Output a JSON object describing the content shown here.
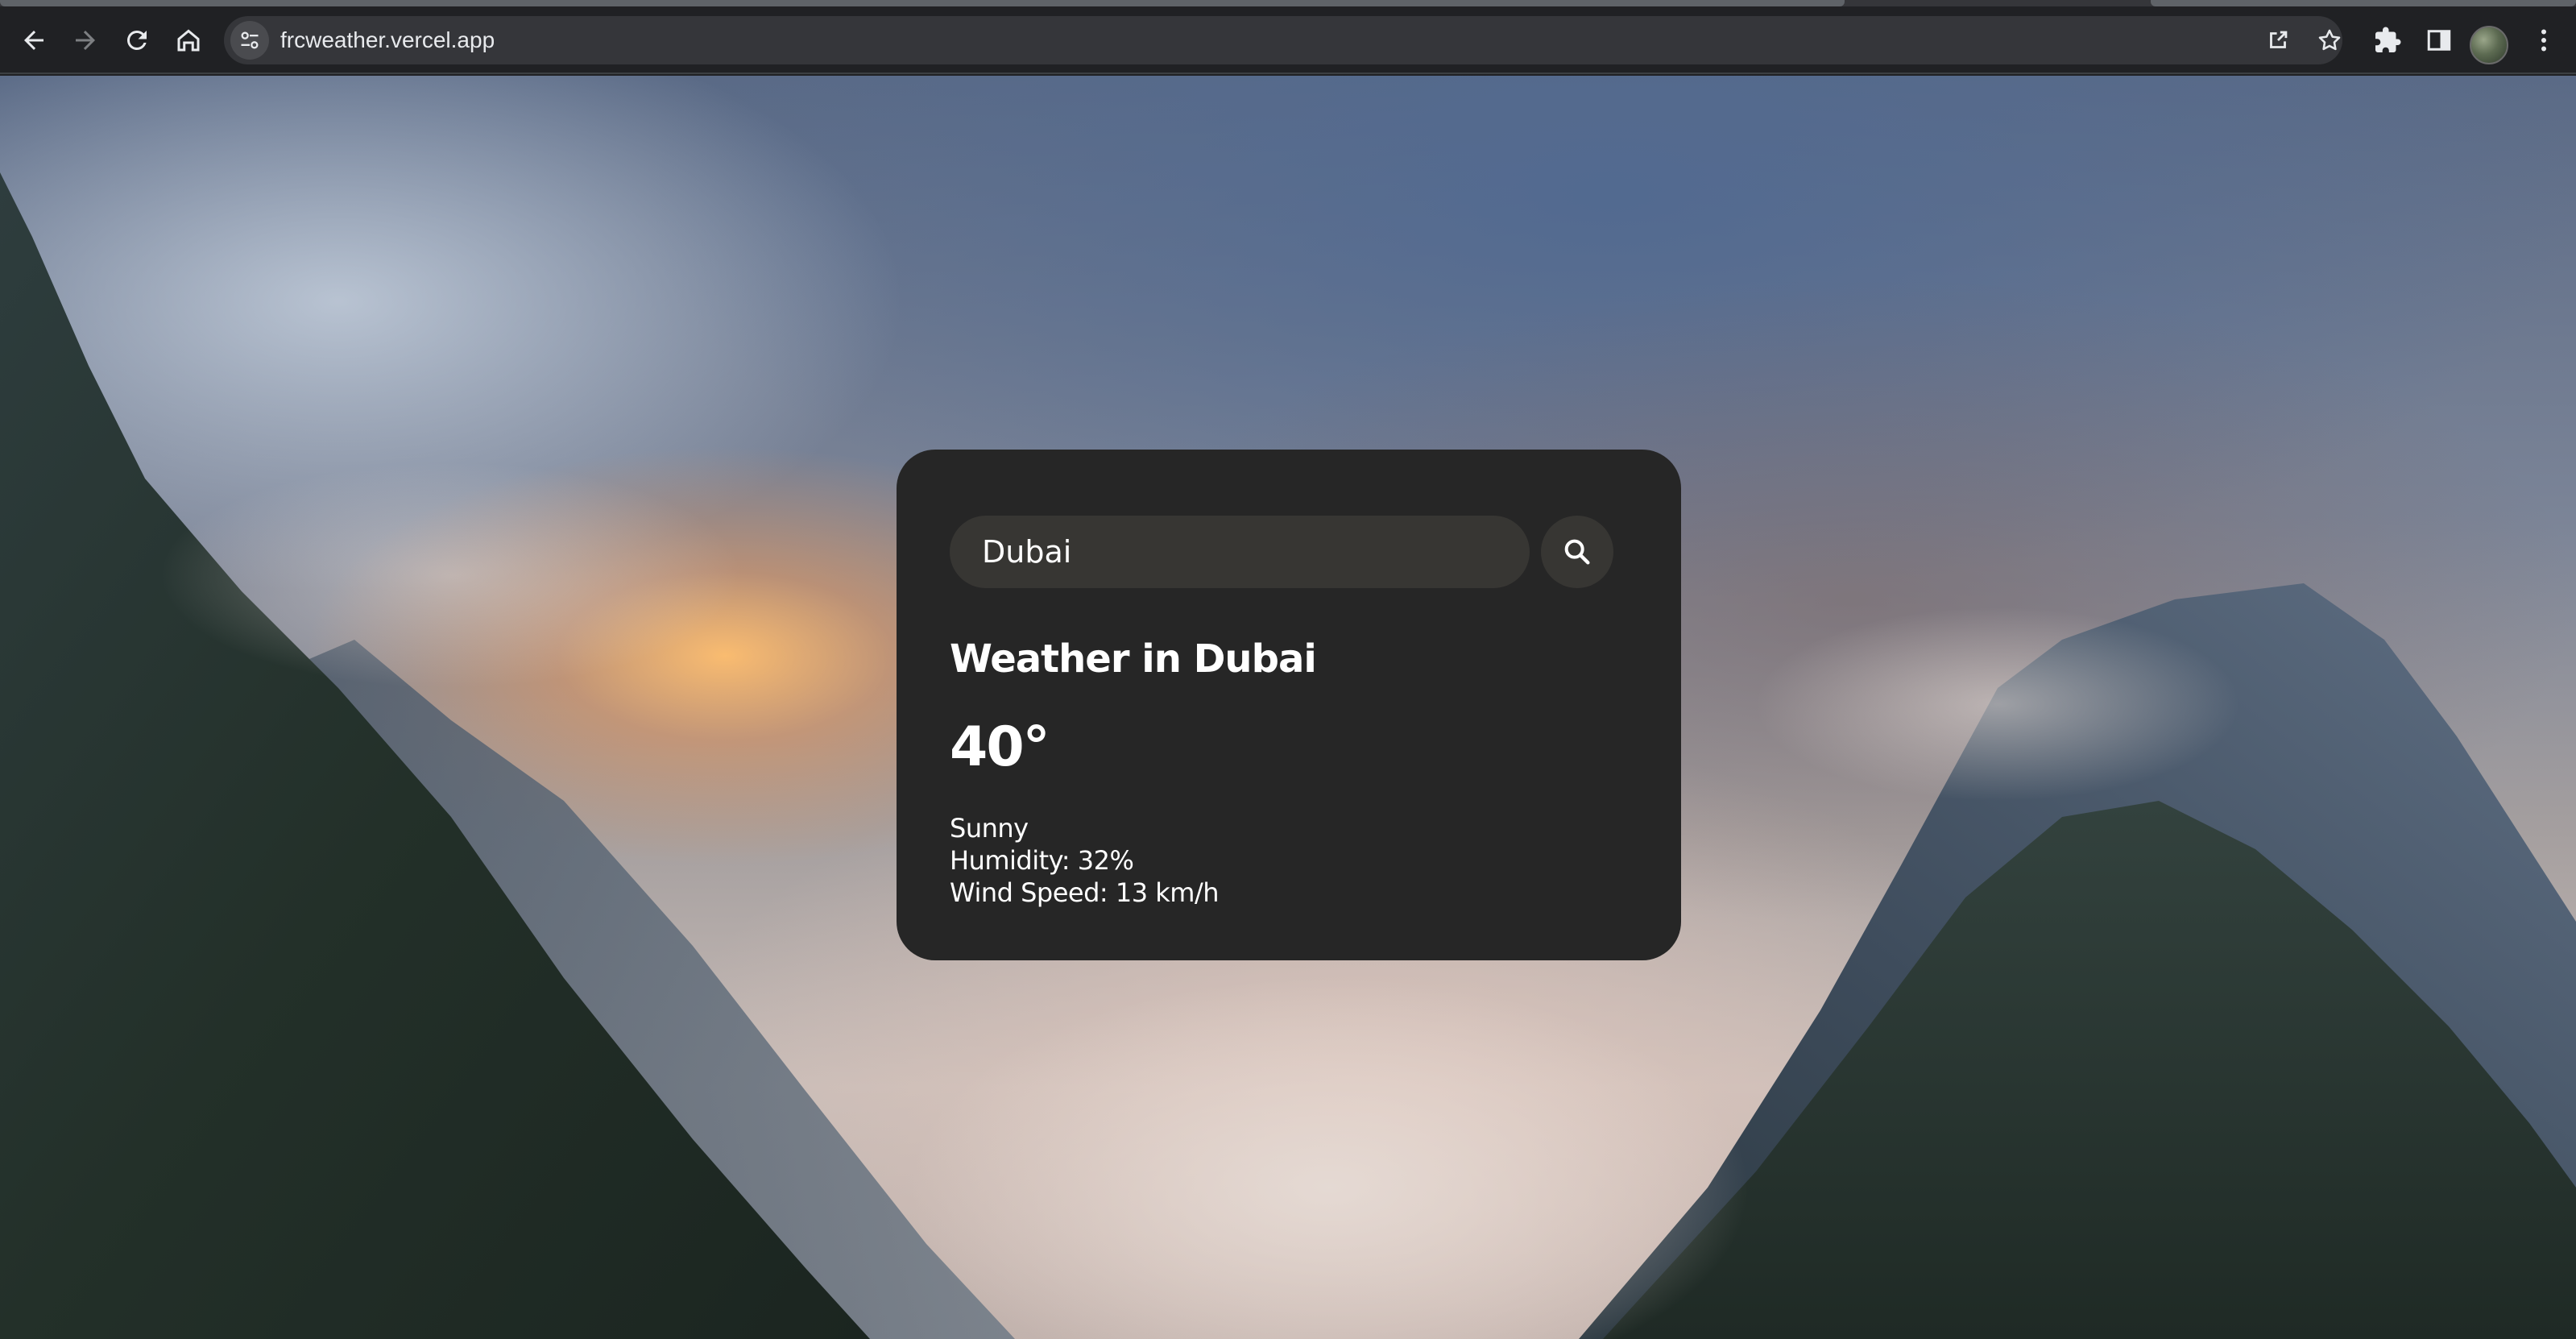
{
  "browser": {
    "url": "frcweather.vercel.app",
    "icons": {
      "back": "arrow-left-icon",
      "forward": "arrow-right-icon",
      "reload": "reload-icon",
      "home": "home-icon",
      "site_info": "tune-icon",
      "share": "share-icon",
      "bookmark": "star-icon",
      "extensions": "puzzle-icon",
      "side_panel": "side-panel-icon",
      "menu": "kebab-menu-icon"
    }
  },
  "weather": {
    "search_value": "Dubai",
    "search_icon": "magnifier-icon",
    "title": "Weather in Dubai",
    "temperature": "40°",
    "description": "Sunny",
    "humidity": "Humidity: 32%",
    "wind": "Wind Speed: 13 km/h"
  },
  "colors": {
    "card_background": "#262626",
    "input_background": "#373633",
    "chrome_background": "#202124",
    "omnibox_background": "#35363a",
    "text": "#ffffff"
  }
}
